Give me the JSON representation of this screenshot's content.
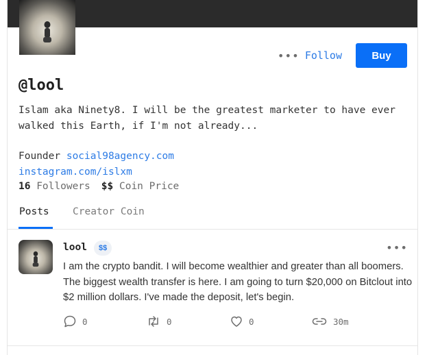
{
  "profile": {
    "handle": "@lool",
    "bio_line": "Islam aka Ninety8. I will be the greatest marketer to have ever walked this Earth, if I'm not already...",
    "role_label": "Founder",
    "website": "social98agency.com",
    "instagram": "instagram.com/islxm",
    "followers_count": "16",
    "followers_label": "Followers",
    "coin_price_value": "$$",
    "coin_price_label": "Coin Price"
  },
  "actions": {
    "more_icon": "more-dots-icon",
    "follow_label": "Follow",
    "buy_label": "Buy"
  },
  "tabs": [
    {
      "label": "Posts",
      "active": true
    },
    {
      "label": "Creator Coin",
      "active": false
    }
  ],
  "post": {
    "username": "lool",
    "coin_badge": "$$",
    "body": "I am the crypto bandit. I will become wealthier and greater than all boomers. The biggest wealth transfer is here. I am going to turn $20,000 on Bitclout into $2 million dollars. I've made the deposit, let's begin.",
    "comments": "0",
    "reposts": "0",
    "likes": "0",
    "time": "30m"
  },
  "colors": {
    "accent": "#0a6ff7",
    "link": "#2c7be5",
    "banner": "#2b2b2b"
  }
}
